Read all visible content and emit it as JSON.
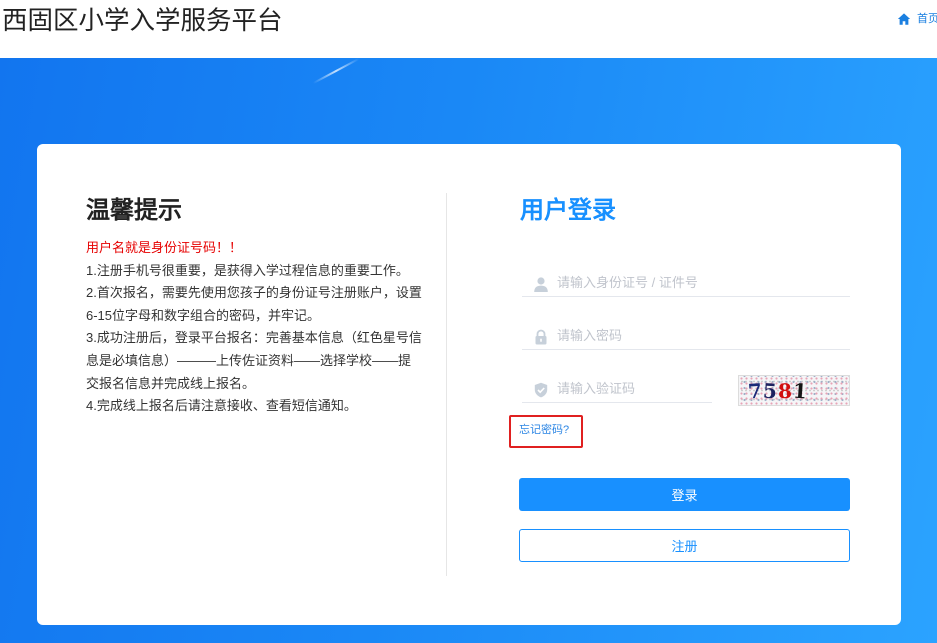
{
  "header": {
    "title": "西固区小学入学服务平台",
    "home_label": "首页"
  },
  "tips": {
    "heading": "温馨提示",
    "warning": "用户名就是身份证号码！！",
    "items": [
      {
        "lines": [
          "1.注册手机号很重要，是获得入学过程信息的重要工作。"
        ]
      },
      {
        "lines": [
          "2.首次报名，需要先使用您孩子的身份证号注册账户，设置",
          "6-15位字母和数字组合的密码，并牢记。"
        ]
      },
      {
        "lines": [
          "3.成功注册后，登录平台报名：完善基本信息（红色星号信",
          "息是必填信息）———上传佐证资料——选择学校——提",
          "交报名信息并完成线上报名。"
        ]
      },
      {
        "lines": [
          "4.完成线上报名后请注意接收、查看短信通知。"
        ]
      }
    ]
  },
  "login": {
    "heading": "用户登录",
    "username_placeholder": "请输入身份证号 / 证件号",
    "password_placeholder": "请输入密码",
    "captcha_placeholder": "请输入验证码",
    "captcha": {
      "digits": [
        "7",
        "5",
        "8",
        "1"
      ],
      "colors": [
        "#1b2a78",
        "#1c2260",
        "#d10f0f",
        "#151515"
      ]
    },
    "forgot_label": "忘记密码?",
    "login_label": "登录",
    "register_label": "注册"
  },
  "icons": {
    "home": "home-icon",
    "username": "user-icon",
    "password": "lock-icon",
    "captcha": "shield-icon"
  },
  "theme": {
    "accent": "#1890ff",
    "warning_text": "#e60000",
    "highlight_box": "#e02020",
    "link": "#2b85e4"
  }
}
